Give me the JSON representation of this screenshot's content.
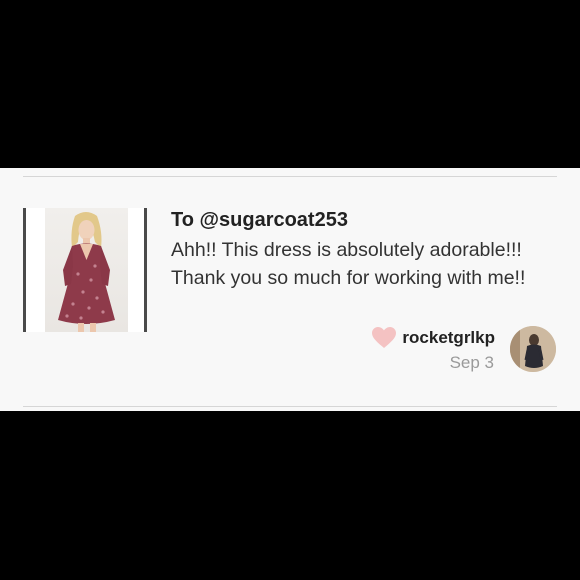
{
  "comment": {
    "recipient": "To @sugarcoat253",
    "message": "Ahh!! This dress is absolutely adorable!!! Thank you so much for working with me!!",
    "username": "rocketgrlkp",
    "date": "Sep 3"
  },
  "icons": {
    "like": "heart-icon"
  },
  "colors": {
    "background": "#000000",
    "card": "#f8f8f8",
    "heart": "#f4c2c2",
    "date": "#9a9a9a"
  }
}
